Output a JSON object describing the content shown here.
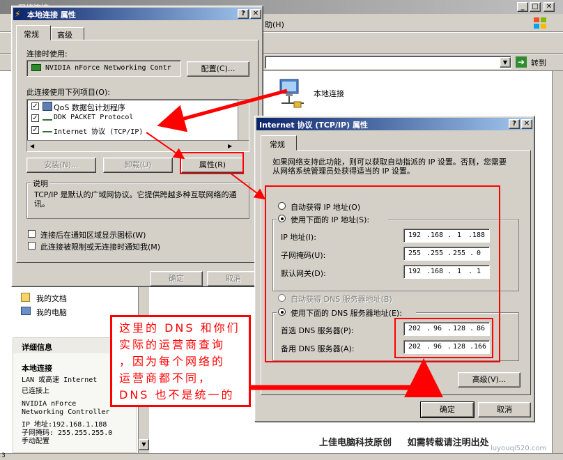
{
  "explorer": {
    "title": "网络连接",
    "menu_fragment": "助(H)",
    "go_label": "转到",
    "icon_label": "本地连接",
    "left_links": [
      "我的文档",
      "我的电脑"
    ],
    "details_title": "详细信息",
    "details_name": "本地连接",
    "details_lines": [
      "LAN 或高速 Internet",
      "已连接上",
      "NVIDIA nForce",
      "Networking Controller",
      "IP 地址:192.168.1.188",
      "子网掩码: 255.255.255.0",
      "手动配置"
    ],
    "status_left": "3"
  },
  "props": {
    "title": "本地连接 属性",
    "tabs": [
      "常规",
      "高级"
    ],
    "connect_using_label": "连接时使用:",
    "adapter_name": "NVIDIA nForce Networking Contr",
    "configure_button": "配置(C)...",
    "items_label": "此连接使用下列项目(O):",
    "items": [
      {
        "label": "QoS 数据包计划程序",
        "checked": true,
        "icon": "qos-icon"
      },
      {
        "label": "DDK PACKET Protocol",
        "checked": true,
        "icon": "protocol-icon"
      },
      {
        "label": "Internet 协议 (TCP/IP)",
        "checked": true,
        "icon": "protocol-icon"
      }
    ],
    "install_button": "安装(N)...",
    "uninstall_button": "卸载(U)",
    "properties_button": "属性(R)",
    "description_title": "说明",
    "description_text": "TCP/IP 是默认的广域网协议。它提供跨越多种互联网络的通讯。",
    "show_icon_label": "连接后在通知区域显示图标(W)",
    "notify_label": "此连接被限制或无连接时通知我(M)",
    "ok_button": "确定",
    "cancel_button": "取消"
  },
  "tcpip": {
    "title": "Internet 协议 (TCP/IP) 属性",
    "tab": "常规",
    "intro": "如果网络支持此功能，则可以获取自动指派的 IP 设置。否则，您需要从网络系统管理员处获得适当的 IP 设置。",
    "auto_ip_label": "自动获得 IP 地址(O)",
    "use_ip_label": "使用下面的 IP 地址(S):",
    "ip_label": "IP 地址(I):",
    "ip_value": [
      "192",
      "168",
      "1",
      "188"
    ],
    "mask_label": "子网掩码(U):",
    "mask_value": [
      "255",
      "255",
      "255",
      "0"
    ],
    "gateway_label": "默认网关(D):",
    "gateway_value": [
      "192",
      "168",
      "1",
      "1"
    ],
    "auto_dns_label": "自动获得 DNS 服务器地址(B)",
    "use_dns_label": "使用下面的 DNS 服务器地址(E):",
    "pref_dns_label": "首选 DNS 服务器(P):",
    "pref_dns_value": [
      "202",
      "96",
      "128",
      "86"
    ],
    "alt_dns_label": "备用 DNS 服务器(A):",
    "alt_dns_value": [
      "202",
      "96",
      "128",
      "166"
    ],
    "advanced_button": "高级(V)...",
    "ok_button": "确定",
    "cancel_button": "取消"
  },
  "annotation": {
    "callout_lines": [
      "这里的 DNS 和你们",
      "实际的运营商查询",
      "，因为每个网络的",
      "运营商都不同，",
      "DNS 也不是统一的"
    ],
    "watermark": "上佳电脑科技原创     如需转载请注明出处",
    "site": "luyouqi520.com",
    "color": "#ff0000"
  }
}
